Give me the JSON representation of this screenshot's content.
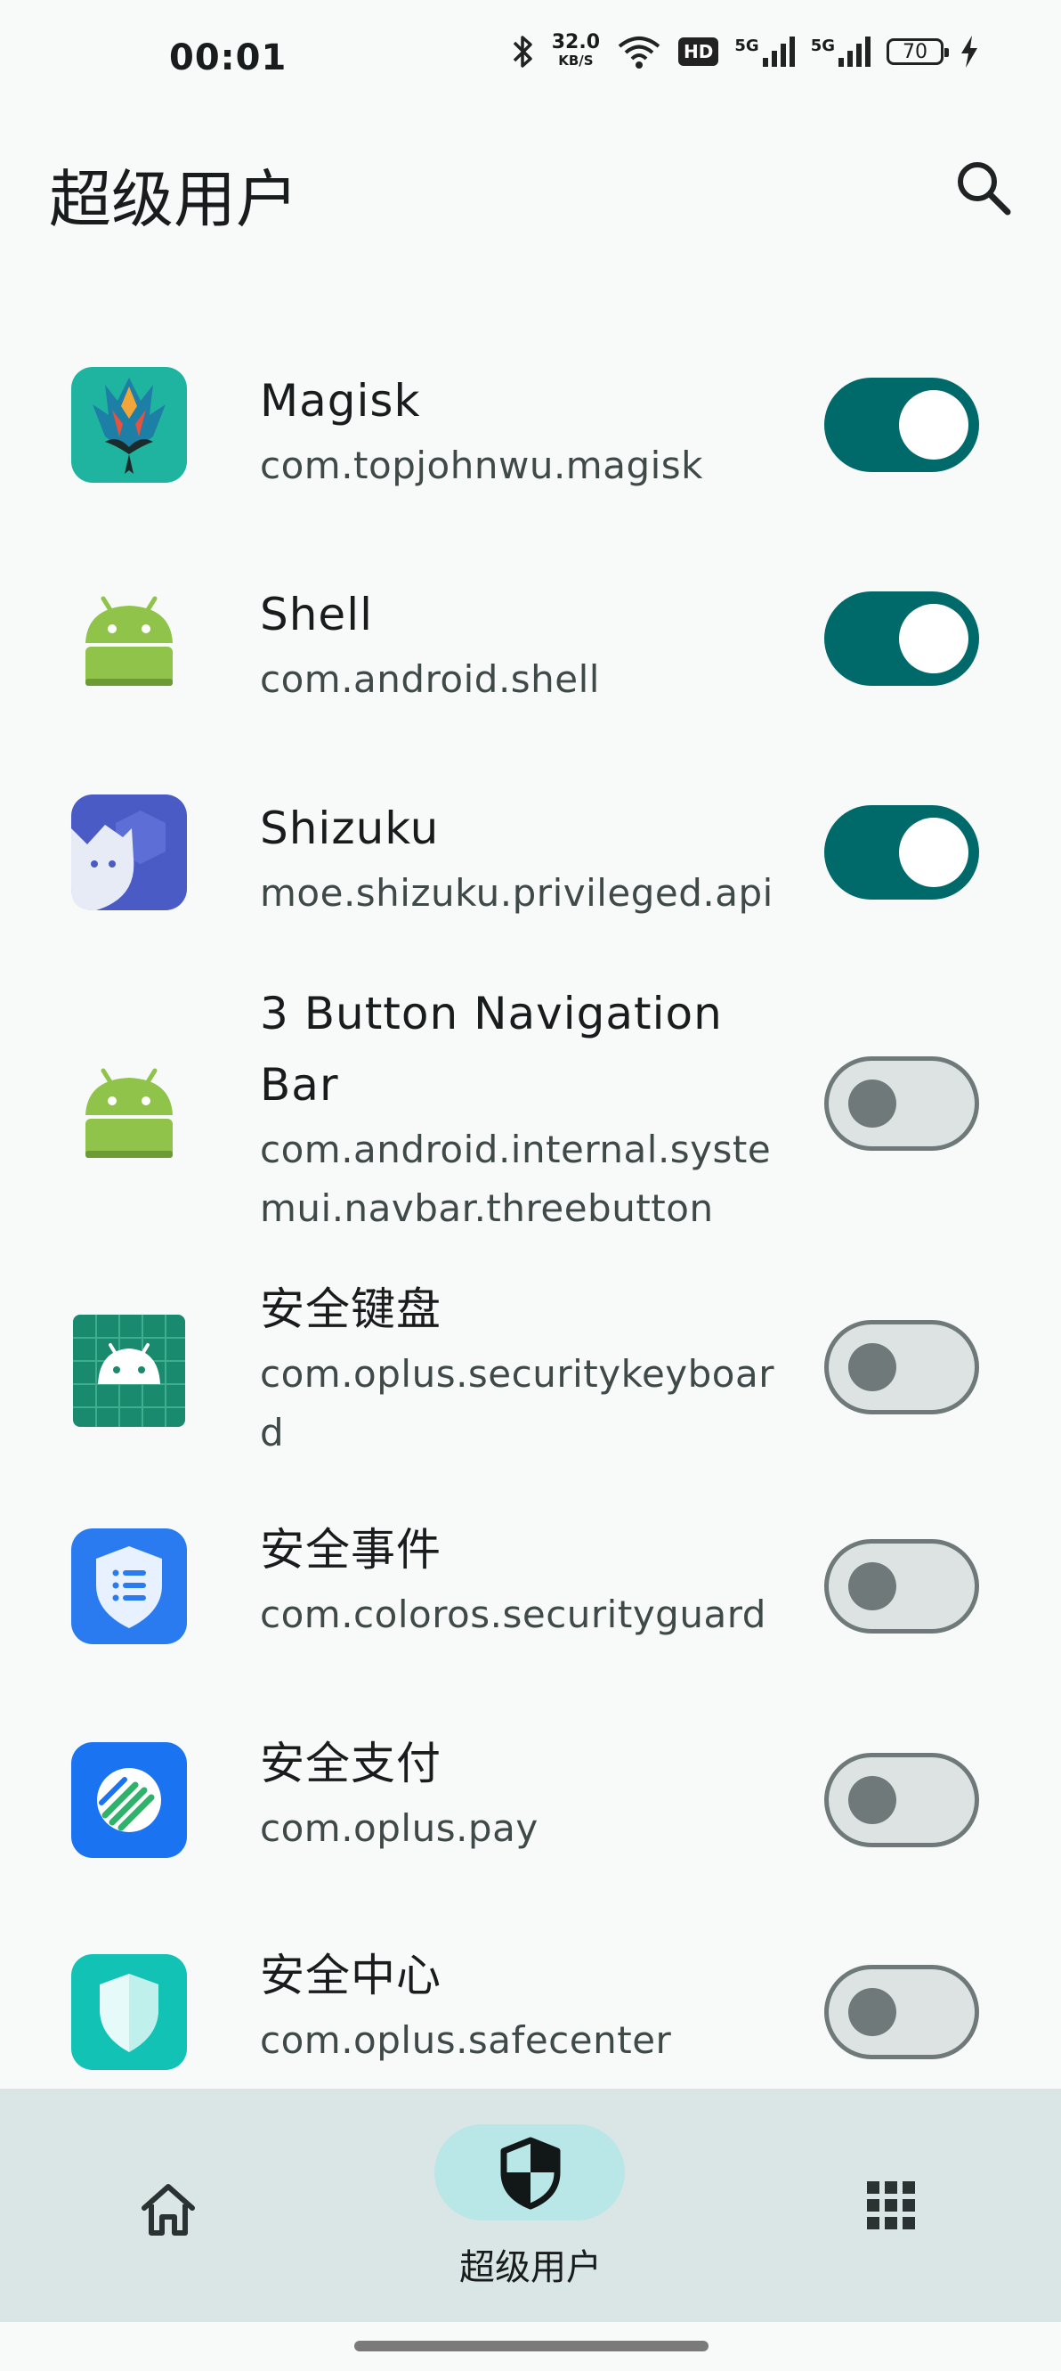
{
  "status_bar": {
    "time": "00:01",
    "net_speed_value": "32.0",
    "net_speed_unit": "KB/S",
    "hd_label": "HD",
    "sim1": "5G",
    "sim2": "5G",
    "battery": "70"
  },
  "header": {
    "title": "超级用户",
    "search_icon": "search-icon"
  },
  "apps": [
    {
      "name": "Magisk",
      "package": "com.topjohnwu.magisk",
      "enabled": true,
      "icon": "magisk-icon"
    },
    {
      "name": "Shell",
      "package": "com.android.shell",
      "enabled": true,
      "icon": "android-icon"
    },
    {
      "name": "Shizuku",
      "package": "moe.shizuku.privileged.api",
      "enabled": true,
      "icon": "shizuku-icon"
    },
    {
      "name": "3 Button Navigation Bar",
      "package": "com.android.internal.systemui.navbar.threebutton",
      "enabled": false,
      "icon": "android-icon"
    },
    {
      "name": "安全键盘",
      "package": "com.oplus.securitykeyboard",
      "enabled": false,
      "icon": "security-keyboard-icon"
    },
    {
      "name": "安全事件",
      "package": "com.coloros.securityguard",
      "enabled": false,
      "icon": "security-event-icon"
    },
    {
      "name": "安全支付",
      "package": "com.oplus.pay",
      "enabled": false,
      "icon": "secure-pay-icon"
    },
    {
      "name": "安全中心",
      "package": "com.oplus.safecenter",
      "enabled": false,
      "icon": "safe-center-icon"
    }
  ],
  "bottom_nav": {
    "home_icon": "home-icon",
    "superuser_icon": "shield-icon",
    "superuser_label": "超级用户",
    "modules_icon": "apps-grid-icon"
  },
  "colors": {
    "accent": "#006a6a",
    "background": "#f7faf9",
    "nav_background": "#dae6e5",
    "nav_active_pill": "#b9e6e6"
  }
}
